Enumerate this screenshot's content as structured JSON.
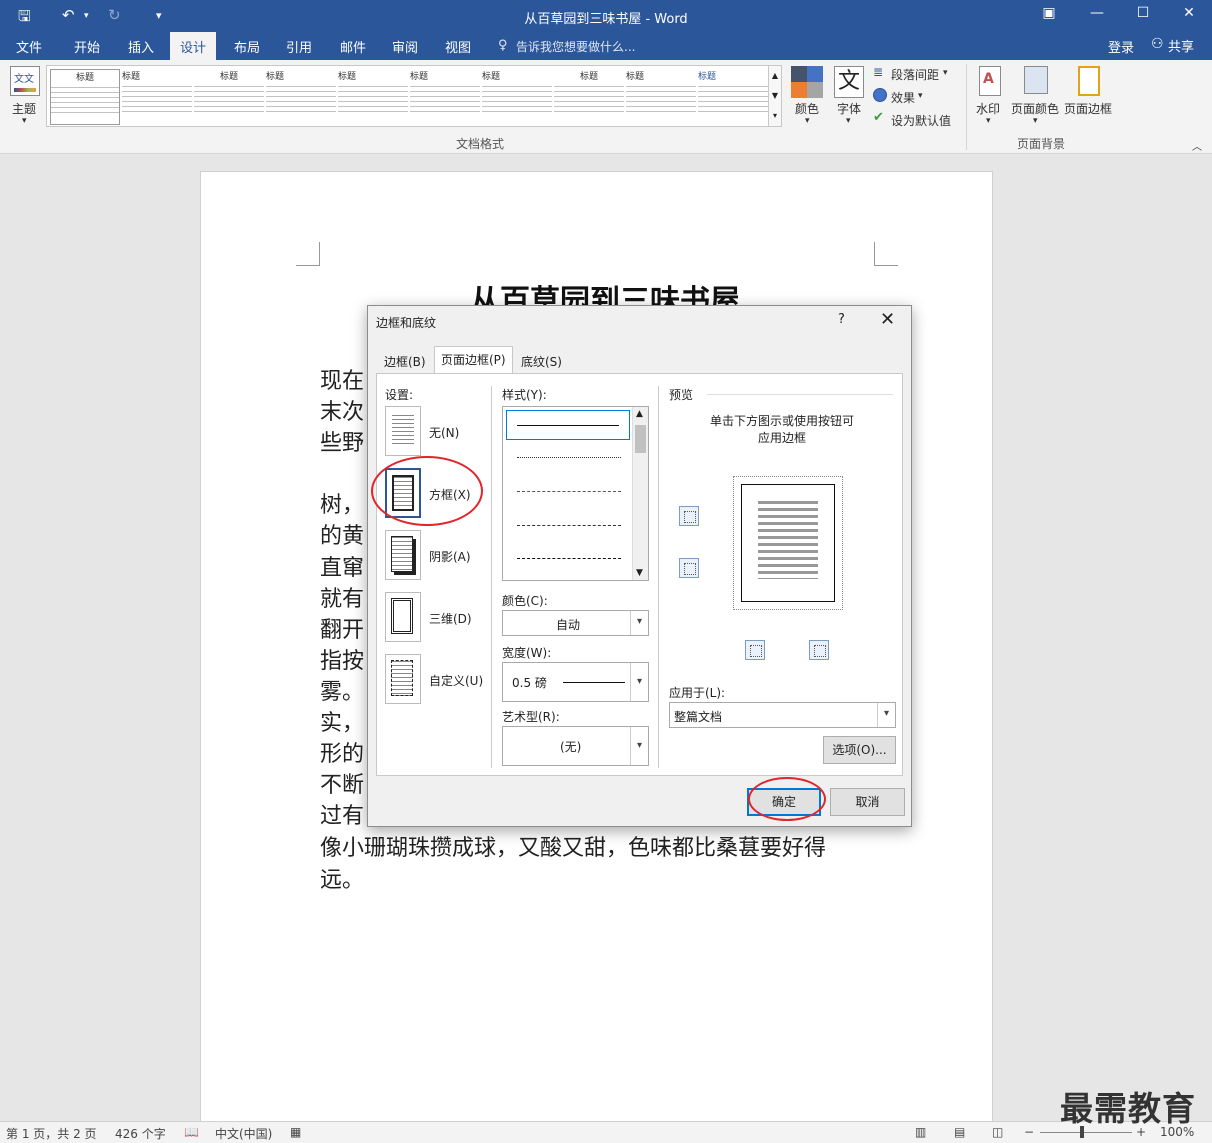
{
  "window": {
    "title": "从百草园到三味书屋 - Word",
    "min": "—",
    "max": "☐",
    "close": "✕"
  },
  "tabs": [
    "文件",
    "开始",
    "插入",
    "设计",
    "布局",
    "引用",
    "邮件",
    "审阅",
    "视图"
  ],
  "tell_me": "告诉我您想要做什么...",
  "login": "登录",
  "share": "共享",
  "ribbon": {
    "theme": "主题",
    "doc_format_group": "文档格式",
    "page_bg_group": "页面背景",
    "colors": "颜色",
    "fonts": "字体",
    "fonts_glyph": "文",
    "para_spacing": "段落间距",
    "effects": "效果",
    "set_default": "设为默认值",
    "watermark": "水印",
    "page_color": "页面颜色",
    "page_border": "页面边框",
    "style_titles": [
      "标题",
      "标题",
      "标题",
      "标题",
      "标题",
      "标题",
      "标题",
      "标题",
      "标题",
      "标题"
    ]
  },
  "document": {
    "title": "从百草园到三味书屋",
    "lines": [
      "现在",
      "末次",
      "些野",
      "树，",
      "的黄",
      "直窜",
      "就有",
      "翻开",
      "指按",
      "雾。",
      "实，",
      "形的",
      "不断",
      "过有",
      "像小珊瑚珠攒成球，又酸又甜，色味都比桑葚要好得",
      "远。"
    ]
  },
  "dialog": {
    "title": "边框和底纹",
    "help": "?",
    "close": "✕",
    "tabs": [
      "边框(B)",
      "页面边框(P)",
      "底纹(S)"
    ],
    "settings_label": "设置:",
    "settings": [
      "无(N)",
      "方框(X)",
      "阴影(A)",
      "三维(D)",
      "自定义(U)"
    ],
    "style_label": "样式(Y):",
    "color_label": "颜色(C):",
    "color_value": "自动",
    "width_label": "宽度(W):",
    "width_value": "0.5 磅",
    "art_label": "艺术型(R):",
    "art_value": "(无)",
    "preview_label": "预览",
    "preview_hint_1": "单击下方图示或使用按钮可",
    "preview_hint_2": "应用边框",
    "apply_label": "应用于(L):",
    "apply_value": "整篇文档",
    "options_button": "选项(O)...",
    "ok_button": "确定",
    "cancel_button": "取消"
  },
  "status": {
    "page": "第 1 页，共 2 页",
    "words": "426 个字",
    "lang": "中文(中国)",
    "zoom": "100%"
  },
  "watermark_text": "最需教育"
}
